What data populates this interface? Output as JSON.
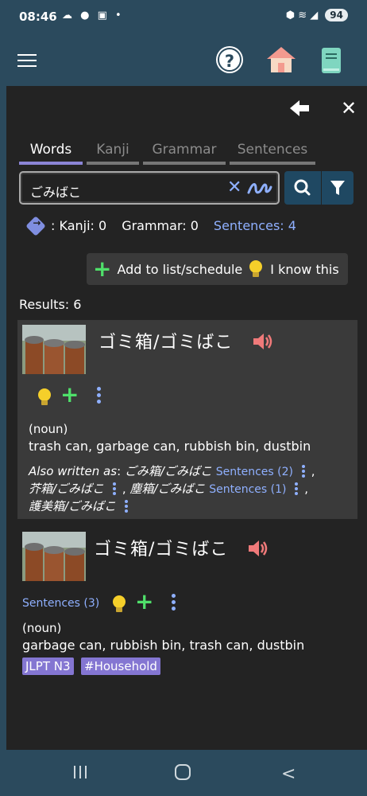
{
  "status_bar": {
    "time": "08:46",
    "battery": "94",
    "left_icons": "☁ ● ▣ •",
    "right_icons": "⬢ ≋ ◢"
  },
  "app_bar": {
    "menu_icon": "hamburger-icon",
    "help_icon": "question-icon",
    "help_glyph": "?",
    "home_icon": "house-icon",
    "book_icon": "book-icon"
  },
  "panel": {
    "back_icon": "arrow-left-icon",
    "close_icon": "close-icon",
    "close_glyph": "✕"
  },
  "tabs": [
    {
      "label": "Words",
      "active": true
    },
    {
      "label": "Kanji",
      "active": false
    },
    {
      "label": "Grammar",
      "active": false
    },
    {
      "label": "Sentences",
      "active": false
    }
  ],
  "search": {
    "value": "ごみばこ",
    "clear_glyph": "✕",
    "search_icon": "search-icon",
    "filter_icon": "filter-icon"
  },
  "counts": {
    "kanji": ": Kanji: 0",
    "grammar": "Grammar: 0",
    "sentences": "Sentences: 4"
  },
  "actions": {
    "add_label": "Add to list/schedule",
    "know_label": "I know this",
    "plus_glyph": "+"
  },
  "results": {
    "label": "Results: 6"
  },
  "entries": [
    {
      "word": "ゴミ箱/ゴミばこ",
      "pos": "(noun)",
      "meaning": "trash can, garbage can, rubbish bin, dustbin",
      "also_label": "Also written as",
      "also_colon": ":",
      "alt1": "ごみ箱/ごみばこ",
      "alt1_sentences": "Sentences (2)",
      "alt2": "芥箱/ごみばこ",
      "alt3": "塵箱/ごみばこ",
      "alt3_sentences": "Sentences (1)",
      "alt4": "護美箱/ごみばこ",
      "sep": ","
    },
    {
      "word": "ゴミ箱/ゴミばこ",
      "sentences": "Sentences (3)",
      "pos": "(noun)",
      "meaning": "garbage can, rubbish bin, trash can, dustbin",
      "badges": [
        "JLPT N3",
        "#Household"
      ]
    }
  ],
  "nav": {
    "recent_icon": "recent-apps-icon",
    "home_icon": "home-circle-icon",
    "back_icon": "back-chevron-icon",
    "back_glyph": "<"
  },
  "colors": {
    "header_bg": "#2b4a5d",
    "panel_bg": "#232323",
    "card_bg": "#3a3a3a",
    "link": "#8fb0ff",
    "accent": "#8b84d6",
    "plus": "#4fe06a",
    "badge": "#8476d2"
  }
}
